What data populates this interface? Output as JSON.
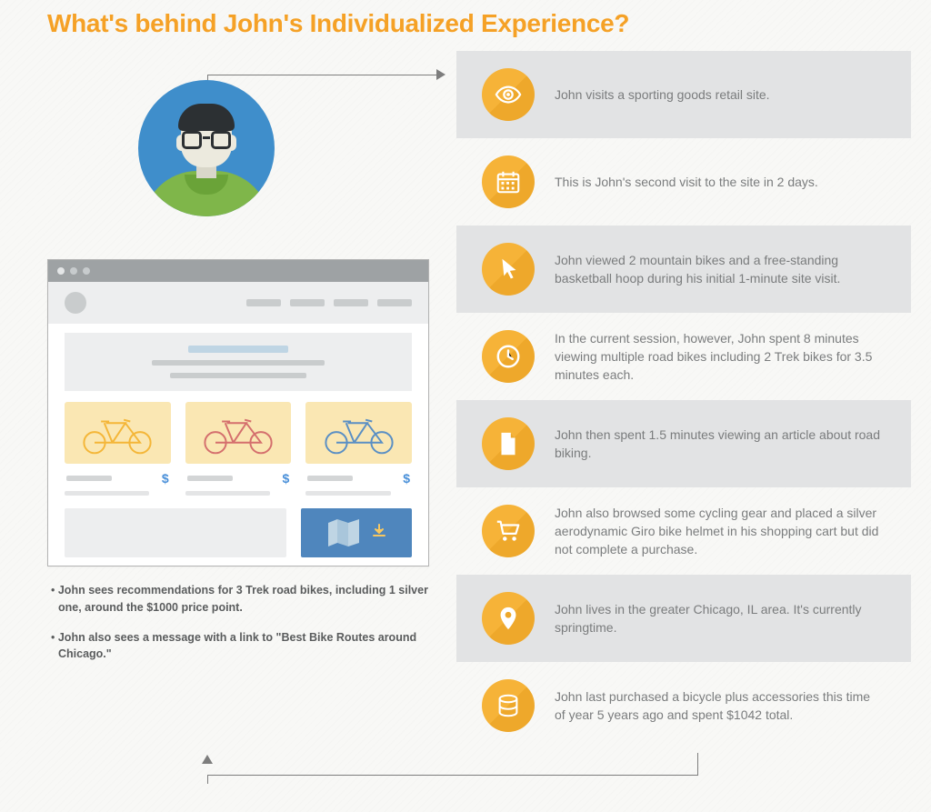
{
  "title": "What's behind John's Individualized Experience?",
  "price_glyph": "$",
  "bullets": {
    "b1": "John sees recommendations for 3 Trek road bikes,  including 1 silver one, around the $1000 price point.",
    "b2": "John also sees a message with a link to \"Best Bike Routes around Chicago.\""
  },
  "items": [
    {
      "icon": "eye",
      "text": "John visits a sporting goods retail site."
    },
    {
      "icon": "calendar",
      "text": "This is John's second visit to the site in 2 days."
    },
    {
      "icon": "cursor",
      "text": "John viewed 2 mountain bikes and a free-standing basketball hoop during his initial 1-minute site visit."
    },
    {
      "icon": "clock",
      "text": "In the current session, however, John spent 8 minutes viewing multiple road bikes including 2 Trek bikes for 3.5 minutes each."
    },
    {
      "icon": "document",
      "text": "John then spent 1.5 minutes viewing an article about road biking."
    },
    {
      "icon": "cart",
      "text": "John also browsed some cycling gear and placed a silver aerodynamic Giro bike helmet in his shopping cart but did not complete a purchase."
    },
    {
      "icon": "pin",
      "text": "John lives in the greater Chicago, IL area. It's currently springtime."
    },
    {
      "icon": "database",
      "text": "John last purchased a bicycle plus accessories this time of year 5 years ago and spent $1042 total."
    }
  ],
  "bike_colors": {
    "b1": "#f4b638",
    "b2": "#d46f6d",
    "b3": "#5a8fc4"
  }
}
